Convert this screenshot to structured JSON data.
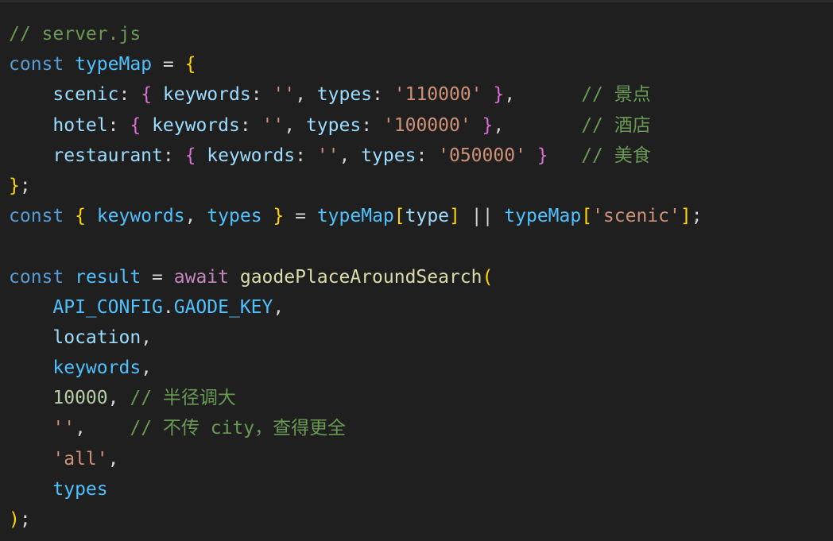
{
  "editor": {
    "language": "javascript",
    "lines": [
      [
        {
          "t": "// server.js",
          "k": "comment"
        }
      ],
      [
        {
          "t": "const",
          "k": "keyword"
        },
        {
          "t": " ",
          "k": "punct"
        },
        {
          "t": "typeMap",
          "k": "variable"
        },
        {
          "t": " = ",
          "k": "punct"
        },
        {
          "t": "{",
          "k": "brace1"
        }
      ],
      [
        {
          "t": "    ",
          "k": "punct"
        },
        {
          "t": "scenic",
          "k": "property"
        },
        {
          "t": ": ",
          "k": "punct"
        },
        {
          "t": "{",
          "k": "brace2"
        },
        {
          "t": " ",
          "k": "punct"
        },
        {
          "t": "keywords",
          "k": "property"
        },
        {
          "t": ": ",
          "k": "punct"
        },
        {
          "t": "''",
          "k": "string"
        },
        {
          "t": ", ",
          "k": "punct"
        },
        {
          "t": "types",
          "k": "property"
        },
        {
          "t": ": ",
          "k": "punct"
        },
        {
          "t": "'110000'",
          "k": "string"
        },
        {
          "t": " ",
          "k": "punct"
        },
        {
          "t": "}",
          "k": "brace2"
        },
        {
          "t": ",      ",
          "k": "punct"
        },
        {
          "t": "// 景点",
          "k": "comment"
        }
      ],
      [
        {
          "t": "    ",
          "k": "punct"
        },
        {
          "t": "hotel",
          "k": "property"
        },
        {
          "t": ": ",
          "k": "punct"
        },
        {
          "t": "{",
          "k": "brace2"
        },
        {
          "t": " ",
          "k": "punct"
        },
        {
          "t": "keywords",
          "k": "property"
        },
        {
          "t": ": ",
          "k": "punct"
        },
        {
          "t": "''",
          "k": "string"
        },
        {
          "t": ", ",
          "k": "punct"
        },
        {
          "t": "types",
          "k": "property"
        },
        {
          "t": ": ",
          "k": "punct"
        },
        {
          "t": "'100000'",
          "k": "string"
        },
        {
          "t": " ",
          "k": "punct"
        },
        {
          "t": "}",
          "k": "brace2"
        },
        {
          "t": ",       ",
          "k": "punct"
        },
        {
          "t": "// 酒店",
          "k": "comment"
        }
      ],
      [
        {
          "t": "    ",
          "k": "punct"
        },
        {
          "t": "restaurant",
          "k": "property"
        },
        {
          "t": ": ",
          "k": "punct"
        },
        {
          "t": "{",
          "k": "brace2"
        },
        {
          "t": " ",
          "k": "punct"
        },
        {
          "t": "keywords",
          "k": "property"
        },
        {
          "t": ": ",
          "k": "punct"
        },
        {
          "t": "''",
          "k": "string"
        },
        {
          "t": ", ",
          "k": "punct"
        },
        {
          "t": "types",
          "k": "property"
        },
        {
          "t": ": ",
          "k": "punct"
        },
        {
          "t": "'050000'",
          "k": "string"
        },
        {
          "t": " ",
          "k": "punct"
        },
        {
          "t": "}",
          "k": "brace2"
        },
        {
          "t": "   ",
          "k": "punct"
        },
        {
          "t": "// 美食",
          "k": "comment"
        }
      ],
      [
        {
          "t": "}",
          "k": "brace1"
        },
        {
          "t": ";",
          "k": "punct"
        }
      ],
      [
        {
          "t": "const",
          "k": "keyword"
        },
        {
          "t": " ",
          "k": "punct"
        },
        {
          "t": "{",
          "k": "brace1"
        },
        {
          "t": " ",
          "k": "punct"
        },
        {
          "t": "keywords",
          "k": "variable"
        },
        {
          "t": ", ",
          "k": "punct"
        },
        {
          "t": "types",
          "k": "variable"
        },
        {
          "t": " ",
          "k": "punct"
        },
        {
          "t": "}",
          "k": "brace1"
        },
        {
          "t": " = ",
          "k": "punct"
        },
        {
          "t": "typeMap",
          "k": "variable"
        },
        {
          "t": "[",
          "k": "brace1"
        },
        {
          "t": "type",
          "k": "property"
        },
        {
          "t": "]",
          "k": "brace1"
        },
        {
          "t": " || ",
          "k": "punct"
        },
        {
          "t": "typeMap",
          "k": "variable"
        },
        {
          "t": "[",
          "k": "brace1"
        },
        {
          "t": "'scenic'",
          "k": "string"
        },
        {
          "t": "]",
          "k": "brace1"
        },
        {
          "t": ";",
          "k": "punct"
        }
      ],
      [],
      [
        {
          "t": "const",
          "k": "keyword"
        },
        {
          "t": " ",
          "k": "punct"
        },
        {
          "t": "result",
          "k": "variable"
        },
        {
          "t": " = ",
          "k": "punct"
        },
        {
          "t": "await",
          "k": "control"
        },
        {
          "t": " ",
          "k": "punct"
        },
        {
          "t": "gaodePlaceAroundSearch",
          "k": "func"
        },
        {
          "t": "(",
          "k": "brace1"
        }
      ],
      [
        {
          "t": "    ",
          "k": "punct"
        },
        {
          "t": "API_CONFIG",
          "k": "variable"
        },
        {
          "t": ".",
          "k": "punct"
        },
        {
          "t": "GAODE_KEY",
          "k": "variable"
        },
        {
          "t": ",",
          "k": "punct"
        }
      ],
      [
        {
          "t": "    ",
          "k": "punct"
        },
        {
          "t": "location",
          "k": "property"
        },
        {
          "t": ",",
          "k": "punct"
        }
      ],
      [
        {
          "t": "    ",
          "k": "punct"
        },
        {
          "t": "keywords",
          "k": "variable"
        },
        {
          "t": ",",
          "k": "punct"
        }
      ],
      [
        {
          "t": "    ",
          "k": "punct"
        },
        {
          "t": "10000",
          "k": "number"
        },
        {
          "t": ", ",
          "k": "punct"
        },
        {
          "t": "// 半径调大",
          "k": "comment"
        }
      ],
      [
        {
          "t": "    ",
          "k": "punct"
        },
        {
          "t": "''",
          "k": "string"
        },
        {
          "t": ",    ",
          "k": "punct"
        },
        {
          "t": "// 不传 city，查得更全",
          "k": "comment"
        }
      ],
      [
        {
          "t": "    ",
          "k": "punct"
        },
        {
          "t": "'all'",
          "k": "string"
        },
        {
          "t": ",",
          "k": "punct"
        }
      ],
      [
        {
          "t": "    ",
          "k": "punct"
        },
        {
          "t": "types",
          "k": "variable"
        }
      ],
      [
        {
          "t": ")",
          "k": "brace1"
        },
        {
          "t": ";",
          "k": "punct"
        }
      ]
    ]
  }
}
